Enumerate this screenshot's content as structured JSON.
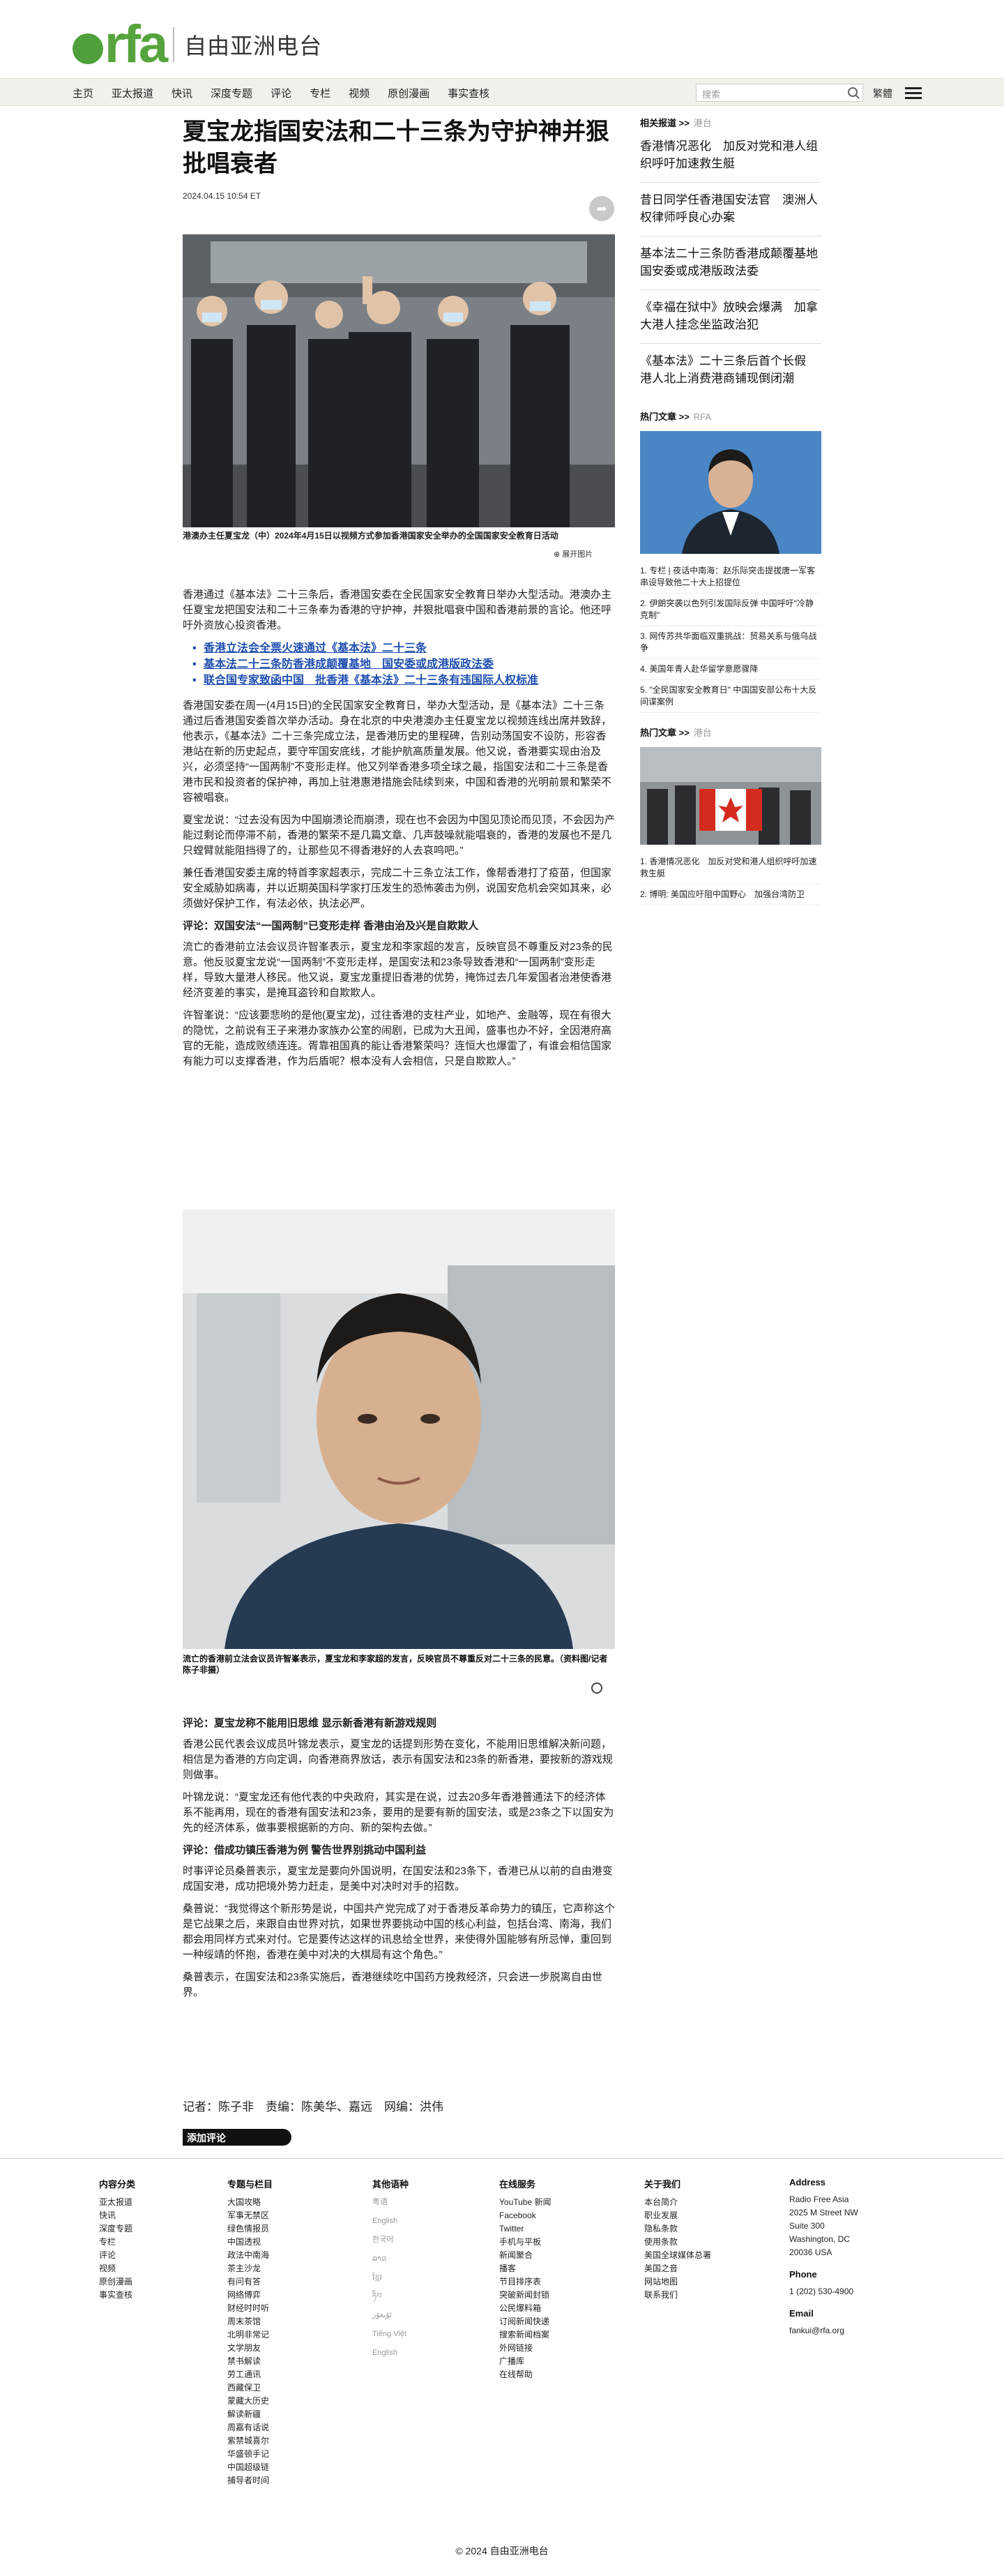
{
  "header": {
    "logo_text": "rfa",
    "site_name": "自由亚洲电台",
    "nav": [
      "主页",
      "亚太报道",
      "快讯",
      "深度专题",
      "评论",
      "专栏",
      "视频",
      "原创漫画",
      "事实查核"
    ],
    "search_placeholder": "搜索",
    "lang_toggle": "繁體"
  },
  "article": {
    "title": "夏宝龙指国安法和二十三条为守护神并狠批唱衰者",
    "date": "2024.04.15 10:54 ET",
    "caption1": "港澳办主任夏宝龙（中）2024年4月15日以视频方式参加香港国家安全举办的全国国家安全教育日活动",
    "zoom_label": "展开图片",
    "lead": "香港通过《基本法》二十三条后，香港国安委在全民国家安全教育日举办大型活动。港澳办主任夏宝龙把国安法和二十三条奉为香港的守护神，并狠批唱衰中国和香港前景的言论。他还呼吁外资放心投资香港。",
    "related_links": [
      "香港立法会全票火速通过《基本法》二十三条",
      "基本法二十三条防香港成颠覆基地　国安委或成港版政法委",
      "联合国专家致函中国　批香港《基本法》二十三条有违国际人权标准"
    ],
    "p1": "香港国安委在周一(4月15日)的全民国家安全教育日，举办大型活动，是《基本法》二十三条通过后香港国安委首次举办活动。身在北京的中央港澳办主任夏宝龙以视频连线出席并致辞，他表示，《基本法》二十三条完成立法，是香港历史的里程碑，告别动荡国安不设防，形容香港站在新的历史起点，要守牢国安底线，才能护航高质量发展。他又说，香港要实现由治及兴，必须坚持“一国两制”不变形走样。他又列举香港多项全球之最，指国安法和二十三条是香港市民和投资者的保护神，再加上驻港惠港措施会陆续到来，中国和香港的光明前景和繁荣不容被唱衰。",
    "p2": "夏宝龙说：“过去没有因为中国崩溃论而崩溃，现在也不会因为中国见顶论而见顶，不会因为产能过剩论而停滞不前，香港的繁荣不是几篇文章、几声鼓噪就能唱衰的，香港的发展也不是几只螳臂就能阻挡得了的，让那些见不得香港好的人去哀鸣吧。”",
    "p3": "兼任香港国安委主席的特首李家超表示，完成二十三条立法工作，像帮香港打了疫苗，但国家安全威胁如病毒，并以近期英国科学家打压发生的恐怖袭击为例，说国安危机会突如其来，必须做好保护工作，有法必依，执法必严。",
    "subhead1": "评论：双国安法“一国两制”已变形走样 香港由治及兴是自欺欺人",
    "p4": "流亡的香港前立法会议员许智峯表示，夏宝龙和李家超的发言，反映官员不尊重反对23条的民意。他反驳夏宝龙说“一国两制”不变形走样，是国安法和23条导致香港和“一国两制”变形走样，导致大量港人移民。他又说，夏宝龙重提旧香港的优势，掩饰过去几年爱国者治港使香港经济变差的事实，是掩耳盗铃和自欺欺人。",
    "p5": "许智峯说：“应该要悲哟的是他(夏宝龙)，过往香港的支柱产业，如地产、金融等，现在有很大的隐忧，之前说有王子来港办家族办公室的闹剧，已成为大丑闻，盛事也办不好，全因港府高官的无能，造成败绩连连。胥靠祖国真的能让香港繁荣吗？连恒大也爆雷了，有谁会相信国家有能力可以支撑香港，作为后盾呢？根本没有人会相信，只是自欺欺人。”",
    "caption2": "流亡的香港前立法会议员许智峯表示，夏宝龙和李家超的发言，反映官员不尊重反对二十三条的民意。（资料图/记者陈子非摄）",
    "subhead2": "评论：夏宝龙称不能用旧思维 显示新香港有新游戏规则",
    "p6": "香港公民代表会议成员叶锦龙表示，夏宝龙的话提到形势在变化，不能用旧思维解决新问题，相信是为香港的方向定调，向香港商界放话，表示有国安法和23条的新香港，要按新的游戏规则做事。",
    "p7": "叶锦龙说：“夏宝龙还有他代表的中央政府，其实是在说，过去20多年香港普通法下的经济体系不能再用，现在的香港有国安法和23条，要用的是要有新的国安法，或是23条之下以国安为先的经济体系，做事要根据新的方向、新的架构去做。”",
    "subhead3": "评论：借成功镇压香港为例 警告世界别挑动中国利益",
    "p8": "时事评论员桑普表示，夏宝龙是要向外国说明，在国安法和23条下，香港已从以前的自由港变成国安港，成功把境外势力赶走，是美中对决时对手的招数。",
    "p9": "桑普说：“我觉得这个新形势是说，中国共产党完成了对于香港反革命势力的镇压，它声称这个是它战果之后，来跟自由世界对抗，如果世界要挑动中国的核心利益，包括台湾、南海，我们都会用同样方式来对付。它是要传达这样的讯息给全世界，来使得外国能够有所忌惮，重回到一种绥靖的怀抱，香港在美中对决的大棋局有这个角色。”",
    "p10": "桑普表示，在国安法和23条实施后，香港继续吃中国药方挽救经济，只会进一步脱离自由世界。",
    "byline": "记者：陈子非　责编：陈美华、嘉远　网编：洪伟",
    "comment_label": "添加评论"
  },
  "sidebar": {
    "related_head": "相关报道 >>",
    "related_tag": "港台",
    "related": [
      "香港情况恶化　加反对党和港人组织呼吁加速救生艇",
      "昔日同学任香港国安法官　澳洲人权律师呼良心办案",
      "基本法二十三条防香港成颠覆基地　国安委或成港版政法委",
      "《幸福在狱中》放映会爆满　加拿大港人挂念坐监政治犯",
      "《基本法》二十三条后首个长假　港人北上消费港商铺现倒闭潮"
    ],
    "hot_head": "热门文章 >>",
    "hot_tag": "RFA",
    "hot": [
      "1. 专栏 | 夜话中南海：赵乐际突击提拔唐一军客串设导致他二十大上招提位",
      "2. 伊朗突袭以色列引发国际反弹  中国呼吁\"冷静克制\"",
      "3. 网传苏共华面临双重挑战：贸易关系与俄乌战争",
      "4. 美国年青人赴华留学意愿骤降",
      "5. \"全民国家安全教育日\" 中国国安部公布十大反间谍案例"
    ],
    "hot2_head": "热门文章 >>",
    "hot2_tag": "港台",
    "hot2": [
      "1. 香港情况恶化　加反对党和港人组织呼吁加速救生艇",
      "2. 博明: 美国应吁阻中国野心　加强台湾防卫"
    ]
  },
  "footer": {
    "col1_head": "内容分类",
    "col1": [
      "亚太报道",
      "快讯",
      "深度专题",
      "专栏",
      "评论",
      "视频",
      "原创漫画",
      "事实查核"
    ],
    "col2_head": "专题与栏目",
    "col2": [
      "大国攻略",
      "军事无禁区",
      "绿色情报员",
      "中国透视",
      "政法中南海",
      "茶主沙龙",
      "有问有答",
      "网络博弈",
      "财经时时听",
      "周末茶馆",
      "北明非常记",
      "文学朋友",
      "禁书解读",
      "劳工通讯",
      "西藏保卫",
      "蒙藏大历史",
      "解读新疆",
      "周嘉有话说",
      "紫禁城喜尔",
      "华盛顿手记",
      "中国超级链",
      "捕导者时间"
    ],
    "col3_head": "其他语种",
    "col3": [
      "粤语",
      "English",
      "한국어",
      "ລາວ",
      "ខ្មែរ",
      "ཏིབ",
      "ئۇيغۇر",
      "Tiếng Việt",
      "English"
    ],
    "col4_head": "在线服务",
    "col4": [
      "YouTube 新闻",
      "Facebook",
      "Twitter",
      "手机与平板",
      "新闻聚合",
      "播客",
      "节目排序表",
      "突破新闻封锁",
      "公民爆料箱",
      "订阅新闻快递",
      "搜索新闻档案",
      "外网链接",
      "广播库",
      "在线帮助"
    ],
    "col5_head": "关于我们",
    "col5": [
      "本台简介",
      "职业发展",
      "隐私条款",
      "使用条款",
      "美国全球媒体总署",
      "美国之音",
      "网站地图",
      "联系我们"
    ],
    "col6_head": "Address",
    "address": [
      "Radio Free Asia",
      "2025 M Street NW",
      "Suite 300",
      "Washington, DC",
      "20036 USA"
    ],
    "phone_head": "Phone",
    "phone": "1 (202) 530-4900",
    "email_head": "Email",
    "email": "fankui@rfa.org",
    "copyright": "© 2024 自由亚洲电台"
  }
}
